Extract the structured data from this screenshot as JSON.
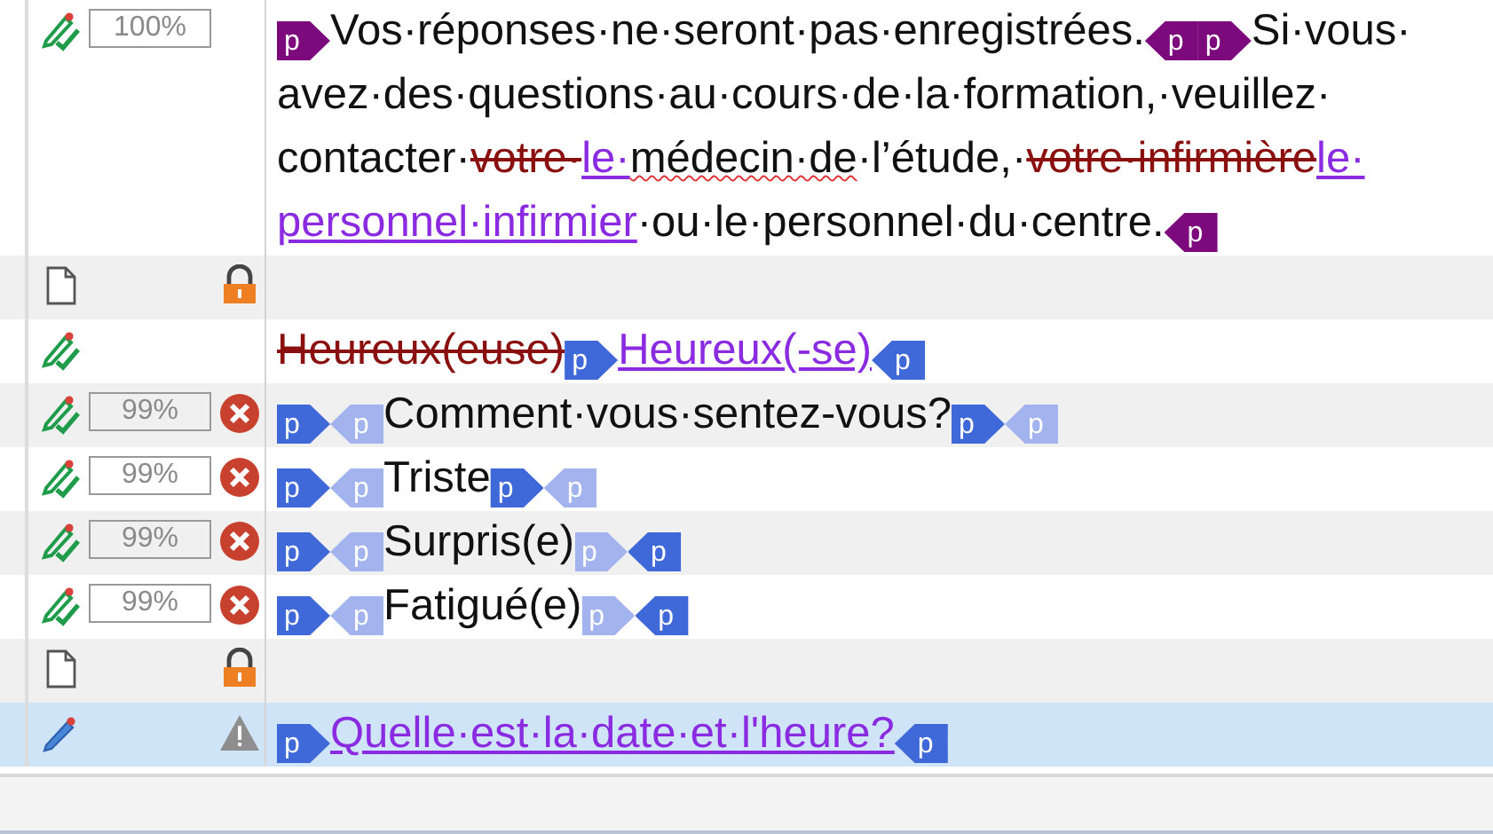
{
  "segments": [
    {
      "kind": "confirmed",
      "match": "100%",
      "error": false,
      "locked": false,
      "warning": false,
      "selected": false,
      "content": [
        {
          "kind": "open-tag",
          "label": "p",
          "color": "#7d0a7d"
        },
        {
          "kind": "text",
          "text": "Vos·réponses·ne·seront·pas·enregistrées."
        },
        {
          "kind": "close-tag",
          "label": "p",
          "color": "#7d0a7d"
        },
        {
          "kind": "open-tag",
          "label": "p",
          "color": "#7d0a7d"
        },
        {
          "kind": "text",
          "text": "Si·vous·"
        },
        {
          "kind": "text",
          "text": "avez·des·questions·au·cours·de·la·formation,·veuillez·"
        },
        {
          "kind": "text",
          "text": "contacter·"
        },
        {
          "kind": "deleted",
          "text": "votre·"
        },
        {
          "kind": "inserted",
          "text": "le·"
        },
        {
          "kind": "misspelled",
          "text": "médecin·de"
        },
        {
          "kind": "text",
          "text": "·l’étude,·"
        },
        {
          "kind": "deleted",
          "text": "votre·infirmière"
        },
        {
          "kind": "inserted",
          "text": "le·"
        },
        {
          "kind": "inserted",
          "text": "personnel·infirmier"
        },
        {
          "kind": "text",
          "text": "·ou·le·personnel·du·centre."
        },
        {
          "kind": "close-tag",
          "label": "p",
          "color": "#7d0a7d"
        }
      ]
    },
    {
      "kind": "empty",
      "error": false,
      "locked": true,
      "warning": false,
      "selected": false
    },
    {
      "kind": "confirmed",
      "error": false,
      "locked": false,
      "warning": false,
      "selected": false,
      "content": [
        {
          "kind": "deleted",
          "text": "Heureux(euse)"
        },
        {
          "kind": "open-tag",
          "label": "p",
          "color": "#3f68d9"
        },
        {
          "kind": "inserted",
          "text": "Heureux(-se)"
        },
        {
          "kind": "close-tag",
          "label": "p",
          "color": "#3f68d9"
        }
      ]
    },
    {
      "kind": "confirmed",
      "match": "99%",
      "error": true,
      "locked": false,
      "warning": false,
      "selected": false,
      "content": [
        {
          "kind": "open-tag",
          "label": "p",
          "color": "#3f68d9"
        },
        {
          "kind": "close-tag",
          "label": "p",
          "color": "#a2b3ee"
        },
        {
          "kind": "text",
          "text": "Comment·vous·sentez-vous?"
        },
        {
          "kind": "open-tag",
          "label": "p",
          "color": "#3f68d9"
        },
        {
          "kind": "close-tag",
          "label": "p",
          "color": "#a2b3ee"
        }
      ]
    },
    {
      "kind": "confirmed",
      "match": "99%",
      "error": true,
      "locked": false,
      "warning": false,
      "selected": false,
      "content": [
        {
          "kind": "open-tag",
          "label": "p",
          "color": "#3f68d9"
        },
        {
          "kind": "close-tag",
          "label": "p",
          "color": "#a2b3ee"
        },
        {
          "kind": "text",
          "text": "Triste"
        },
        {
          "kind": "open-tag",
          "label": "p",
          "color": "#3f68d9"
        },
        {
          "kind": "close-tag",
          "label": "p",
          "color": "#a2b3ee"
        }
      ]
    },
    {
      "kind": "confirmed",
      "match": "99%",
      "error": true,
      "locked": false,
      "warning": false,
      "selected": false,
      "content": [
        {
          "kind": "open-tag",
          "label": "p",
          "color": "#3f68d9"
        },
        {
          "kind": "close-tag",
          "label": "p",
          "color": "#a2b3ee"
        },
        {
          "kind": "text",
          "text": "Surpris(e)"
        },
        {
          "kind": "open-tag",
          "label": "p",
          "color": "#a2b3ee"
        },
        {
          "kind": "close-tag",
          "label": "p",
          "color": "#3f68d9"
        }
      ]
    },
    {
      "kind": "confirmed",
      "match": "99%",
      "error": true,
      "locked": false,
      "warning": false,
      "selected": false,
      "content": [
        {
          "kind": "open-tag",
          "label": "p",
          "color": "#3f68d9"
        },
        {
          "kind": "close-tag",
          "label": "p",
          "color": "#a2b3ee"
        },
        {
          "kind": "text",
          "text": "Fatigué(e)"
        },
        {
          "kind": "open-tag",
          "label": "p",
          "color": "#a2b3ee"
        },
        {
          "kind": "close-tag",
          "label": "p",
          "color": "#3f68d9"
        }
      ]
    },
    {
      "kind": "empty",
      "error": false,
      "locked": true,
      "warning": false,
      "selected": false
    },
    {
      "kind": "editing",
      "error": false,
      "locked": false,
      "warning": true,
      "selected": true,
      "content": [
        {
          "kind": "open-tag",
          "label": "p",
          "color": "#3f68d9"
        },
        {
          "kind": "inserted",
          "text": "Quelle·est·la·date·et·l'heure?"
        },
        {
          "kind": "close-tag",
          "label": "p",
          "color": "#3f68d9"
        }
      ]
    }
  ]
}
